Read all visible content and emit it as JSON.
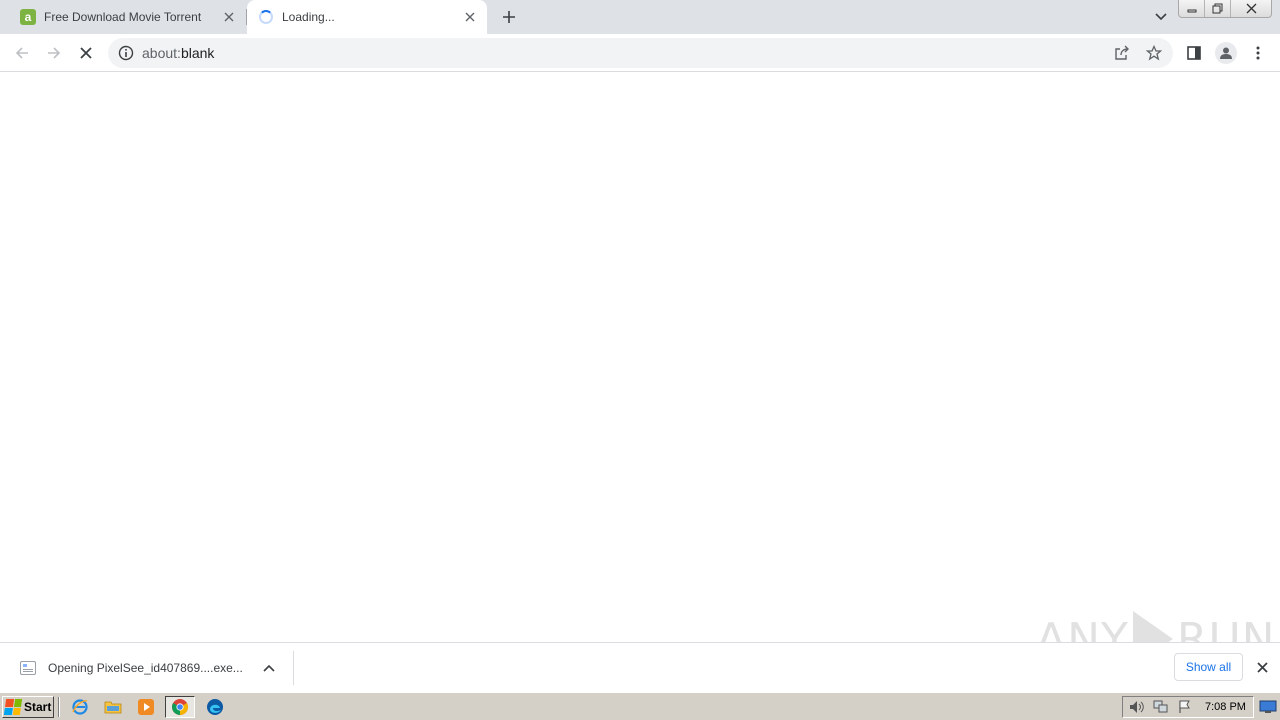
{
  "tabs": [
    {
      "favicon_letter": "a",
      "title": "Free Download Movie Torrent"
    },
    {
      "title": "Loading..."
    }
  ],
  "address_bar": {
    "scheme": "about:",
    "host": "blank"
  },
  "download_bar": {
    "item_label": "Opening PixelSee_id407869....exe...",
    "show_all_label": "Show all"
  },
  "watermark": {
    "left_text": "ANY",
    "right_text": "RUN"
  },
  "taskbar": {
    "start_label": "Start",
    "clock": "7:08 PM"
  },
  "colors": {
    "tab_strip": "#dee1e6",
    "accent_blue": "#1a73e8",
    "favicon_green": "#7cb342",
    "taskbar": "#d4d0c8"
  }
}
